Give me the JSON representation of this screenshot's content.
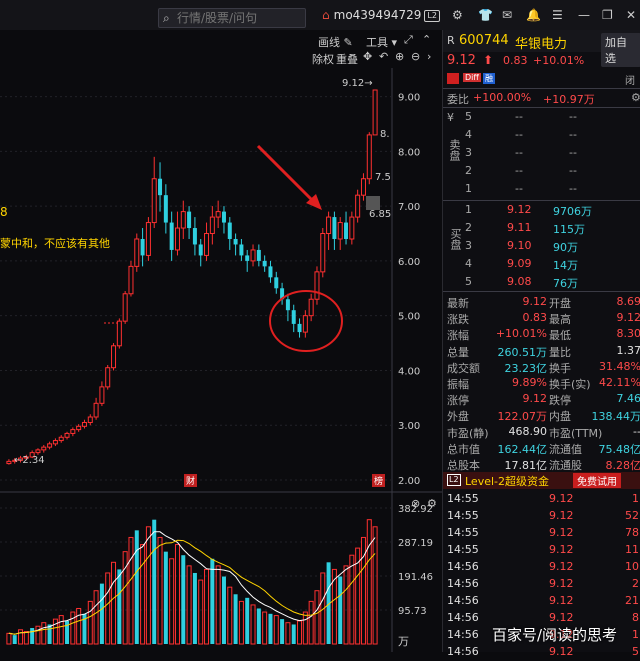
{
  "top": {
    "search_placeholder": "行情/股票/问句",
    "username": "mo439494729",
    "level_badge": "L2"
  },
  "chart_toolbar": {
    "draw_label": "画线",
    "tools_label": "工具",
    "fuquan": "除权",
    "overlay": "重叠"
  },
  "annotation": {
    "number": "8",
    "text": "蒙中和，不应该有其他"
  },
  "price_chart": {
    "y_ticks": [
      "9.00",
      "8.00",
      "7.00",
      "6.00",
      "5.00",
      "4.00",
      "3.00",
      "2.00"
    ],
    "high_label": "9.12→",
    "low_label": "←2.34",
    "label_8": "8.",
    "label_75": "7.5",
    "label_685": "6.85",
    "marker_cai": "财",
    "marker_bang": "榜"
  },
  "volume_chart": {
    "y_ticks": [
      "382.92",
      "287.19",
      "191.46",
      "95.73"
    ],
    "unit": "万"
  },
  "chart_data": {
    "type": "candlestick",
    "price_range": [
      2.0,
      9.12
    ],
    "price_bars": [
      [
        2.3,
        2.34,
        2.28,
        2.38,
        1
      ],
      [
        2.34,
        2.36,
        2.3,
        2.4,
        1
      ],
      [
        2.36,
        2.4,
        2.32,
        2.44,
        1
      ],
      [
        2.4,
        2.42,
        2.36,
        2.46,
        1
      ],
      [
        2.42,
        2.5,
        2.4,
        2.54,
        1
      ],
      [
        2.5,
        2.55,
        2.46,
        2.58,
        1
      ],
      [
        2.55,
        2.6,
        2.5,
        2.64,
        1
      ],
      [
        2.6,
        2.66,
        2.56,
        2.7,
        1
      ],
      [
        2.66,
        2.72,
        2.62,
        2.76,
        1
      ],
      [
        2.72,
        2.78,
        2.68,
        2.82,
        1
      ],
      [
        2.78,
        2.85,
        2.74,
        2.88,
        1
      ],
      [
        2.85,
        2.92,
        2.8,
        2.96,
        1
      ],
      [
        2.92,
        2.98,
        2.88,
        3.02,
        1
      ],
      [
        2.98,
        3.05,
        2.94,
        3.1,
        1
      ],
      [
        3.05,
        3.15,
        3.0,
        3.2,
        1
      ],
      [
        3.15,
        3.4,
        3.1,
        3.5,
        1
      ],
      [
        3.4,
        3.7,
        3.35,
        3.8,
        1
      ],
      [
        3.7,
        4.05,
        3.65,
        4.1,
        1
      ],
      [
        4.05,
        4.45,
        4.0,
        4.5,
        1
      ],
      [
        4.45,
        4.9,
        4.4,
        4.95,
        1
      ],
      [
        4.9,
        5.4,
        4.85,
        5.45,
        1
      ],
      [
        5.4,
        5.9,
        5.35,
        6.0,
        1
      ],
      [
        5.9,
        6.4,
        5.8,
        6.5,
        1
      ],
      [
        6.4,
        6.1,
        5.9,
        6.6,
        0
      ],
      [
        6.1,
        6.7,
        6.0,
        6.8,
        1
      ],
      [
        6.7,
        7.5,
        6.6,
        7.9,
        1
      ],
      [
        7.5,
        7.2,
        6.9,
        7.8,
        0
      ],
      [
        7.2,
        6.7,
        6.5,
        7.4,
        0
      ],
      [
        6.7,
        6.2,
        6.0,
        6.9,
        0
      ],
      [
        6.2,
        6.6,
        6.1,
        6.9,
        1
      ],
      [
        6.6,
        6.9,
        6.4,
        7.1,
        1
      ],
      [
        6.9,
        6.6,
        6.4,
        7.0,
        0
      ],
      [
        6.6,
        6.3,
        6.1,
        6.8,
        0
      ],
      [
        6.3,
        6.1,
        5.9,
        6.4,
        0
      ],
      [
        6.1,
        6.5,
        6.0,
        6.7,
        1
      ],
      [
        6.5,
        6.8,
        6.3,
        7.0,
        1
      ],
      [
        6.8,
        6.9,
        6.6,
        7.1,
        1
      ],
      [
        6.9,
        6.7,
        6.5,
        7.0,
        0
      ],
      [
        6.7,
        6.4,
        6.2,
        6.8,
        0
      ],
      [
        6.4,
        6.3,
        6.1,
        6.5,
        0
      ],
      [
        6.3,
        6.1,
        6.0,
        6.4,
        0
      ],
      [
        6.1,
        6.0,
        5.8,
        6.2,
        0
      ],
      [
        6.0,
        6.2,
        5.9,
        6.3,
        1
      ],
      [
        6.2,
        6.0,
        5.9,
        6.3,
        0
      ],
      [
        6.0,
        5.9,
        5.8,
        6.1,
        0
      ],
      [
        5.9,
        5.7,
        5.6,
        6.0,
        0
      ],
      [
        5.7,
        5.5,
        5.4,
        5.8,
        0
      ],
      [
        5.5,
        5.3,
        5.2,
        5.6,
        0
      ],
      [
        5.3,
        5.1,
        4.9,
        5.4,
        0
      ],
      [
        5.1,
        4.85,
        4.7,
        5.2,
        0
      ],
      [
        4.85,
        4.7,
        4.6,
        4.95,
        0
      ],
      [
        4.7,
        5.0,
        4.6,
        5.1,
        1
      ],
      [
        5.0,
        5.3,
        4.9,
        5.4,
        1
      ],
      [
        5.3,
        5.8,
        5.2,
        5.9,
        1
      ],
      [
        5.8,
        6.5,
        5.7,
        6.6,
        1
      ],
      [
        6.5,
        6.8,
        6.2,
        6.9,
        1
      ],
      [
        6.8,
        6.4,
        6.2,
        6.9,
        0
      ],
      [
        6.4,
        6.7,
        6.2,
        6.8,
        1
      ],
      [
        6.7,
        6.4,
        6.3,
        6.9,
        0
      ],
      [
        6.4,
        6.8,
        6.3,
        6.9,
        1
      ],
      [
        6.8,
        7.2,
        6.7,
        7.3,
        1
      ],
      [
        7.2,
        7.5,
        7.1,
        7.6,
        1
      ],
      [
        7.5,
        8.3,
        7.4,
        8.35,
        1
      ],
      [
        8.3,
        9.12,
        8.3,
        9.12,
        1
      ]
    ],
    "volume_range": [
      0,
      382.92
    ],
    "volume_bars": [
      [
        30,
        1
      ],
      [
        25,
        0
      ],
      [
        40,
        1
      ],
      [
        35,
        1
      ],
      [
        45,
        0
      ],
      [
        50,
        1
      ],
      [
        60,
        1
      ],
      [
        55,
        0
      ],
      [
        70,
        1
      ],
      [
        80,
        1
      ],
      [
        65,
        0
      ],
      [
        90,
        1
      ],
      [
        100,
        1
      ],
      [
        85,
        0
      ],
      [
        120,
        1
      ],
      [
        150,
        1
      ],
      [
        170,
        0
      ],
      [
        200,
        1
      ],
      [
        230,
        1
      ],
      [
        210,
        0
      ],
      [
        260,
        1
      ],
      [
        300,
        1
      ],
      [
        320,
        0
      ],
      [
        280,
        1
      ],
      [
        330,
        1
      ],
      [
        350,
        0
      ],
      [
        300,
        1
      ],
      [
        260,
        0
      ],
      [
        240,
        1
      ],
      [
        280,
        1
      ],
      [
        250,
        0
      ],
      [
        220,
        1
      ],
      [
        200,
        0
      ],
      [
        180,
        1
      ],
      [
        210,
        1
      ],
      [
        240,
        0
      ],
      [
        220,
        1
      ],
      [
        190,
        0
      ],
      [
        160,
        1
      ],
      [
        140,
        0
      ],
      [
        120,
        1
      ],
      [
        130,
        0
      ],
      [
        110,
        1
      ],
      [
        100,
        0
      ],
      [
        90,
        1
      ],
      [
        85,
        0
      ],
      [
        80,
        1
      ],
      [
        70,
        0
      ],
      [
        60,
        1
      ],
      [
        55,
        0
      ],
      [
        65,
        1
      ],
      [
        90,
        1
      ],
      [
        120,
        1
      ],
      [
        150,
        1
      ],
      [
        200,
        1
      ],
      [
        230,
        0
      ],
      [
        210,
        1
      ],
      [
        190,
        0
      ],
      [
        220,
        1
      ],
      [
        250,
        1
      ],
      [
        270,
        1
      ],
      [
        300,
        1
      ],
      [
        350,
        1
      ],
      [
        330,
        1
      ]
    ]
  },
  "stock": {
    "prefix": "R",
    "code": "600744",
    "name": "华银电力",
    "add_btn": "加自选",
    "price": "9.12",
    "change": "0.83",
    "change_pct": "+10.01%",
    "tags": [
      "Diff",
      "融"
    ],
    "extra_tab": "闭"
  },
  "weibi": {
    "label": "委比",
    "v1": "+100.00%",
    "v2": "+10.97万"
  },
  "sell_side": {
    "label": "卖盘",
    "rows": [
      {
        "n": "5",
        "p": "--",
        "v": "--"
      },
      {
        "n": "4",
        "p": "--",
        "v": "--"
      },
      {
        "n": "3",
        "p": "--",
        "v": "--"
      },
      {
        "n": "2",
        "p": "--",
        "v": "--"
      },
      {
        "n": "1",
        "p": "--",
        "v": "--"
      }
    ]
  },
  "buy_side": {
    "label": "买盘",
    "rows": [
      {
        "n": "1",
        "p": "9.12",
        "v": "9706万"
      },
      {
        "n": "2",
        "p": "9.11",
        "v": "115万"
      },
      {
        "n": "3",
        "p": "9.10",
        "v": "90万"
      },
      {
        "n": "4",
        "p": "9.09",
        "v": "14万"
      },
      {
        "n": "5",
        "p": "9.08",
        "v": "76万"
      }
    ]
  },
  "stats": [
    {
      "k1": "最新",
      "v1": "9.12",
      "k2": "开盘",
      "v2": "8.69"
    },
    {
      "k1": "涨跌",
      "v1": "0.83",
      "k2": "最高",
      "v2": "9.12"
    },
    {
      "k1": "涨幅",
      "v1": "+10.01%",
      "k2": "最低",
      "v2": "8.30"
    },
    {
      "k1": "总量",
      "v1": "260.51万",
      "k2": "量比",
      "v2": "1.37"
    },
    {
      "k1": "成交额",
      "v1": "23.23亿",
      "k2": "换手",
      "v2": "31.48%"
    },
    {
      "k1": "振幅",
      "v1": "9.89%",
      "k2": "换手(实)",
      "v2": "42.11%"
    },
    {
      "k1": "涨停",
      "v1": "9.12",
      "k2": "跌停",
      "v2": "7.46"
    },
    {
      "k1": "外盘",
      "v1": "122.07万",
      "k2": "内盘",
      "v2": "138.44万"
    },
    {
      "k1": "市盈(静)",
      "v1": "468.90",
      "k2": "市盈(TTM)",
      "v2": "--"
    },
    {
      "k1": "总市值",
      "v1": "162.44亿",
      "k2": "流通值",
      "v2": "75.48亿"
    },
    {
      "k1": "总股本",
      "v1": "17.81亿",
      "k2": "流通股",
      "v2": "8.28亿"
    }
  ],
  "l2": {
    "badge": "L2",
    "label": "Level-2超级资金",
    "trial": "免费试用"
  },
  "ticks": [
    {
      "t": "14:55",
      "p": "9.12",
      "v": "1"
    },
    {
      "t": "14:55",
      "p": "9.12",
      "v": "52"
    },
    {
      "t": "14:55",
      "p": "9.12",
      "v": "78"
    },
    {
      "t": "14:55",
      "p": "9.12",
      "v": "11"
    },
    {
      "t": "14:56",
      "p": "9.12",
      "v": "10"
    },
    {
      "t": "14:56",
      "p": "9.12",
      "v": "2"
    },
    {
      "t": "14:56",
      "p": "9.12",
      "v": "21"
    },
    {
      "t": "14:56",
      "p": "9.12",
      "v": "8"
    },
    {
      "t": "14:56",
      "p": "9.12",
      "v": "1"
    },
    {
      "t": "14:56",
      "p": "9.12",
      "v": "5"
    }
  ],
  "watermark": "百家号/阅读的思考"
}
